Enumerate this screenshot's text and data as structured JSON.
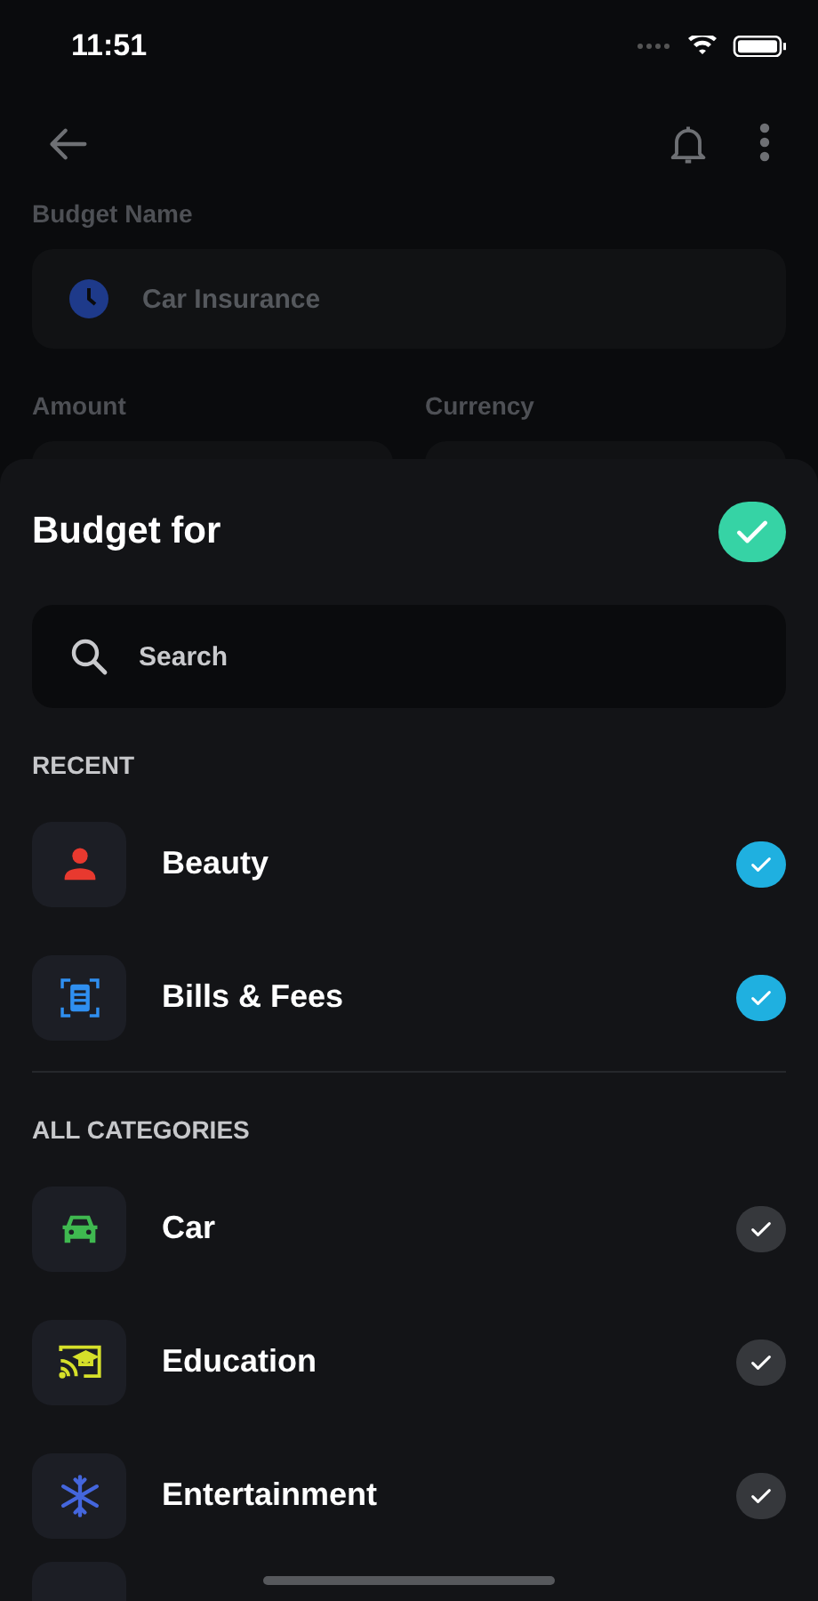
{
  "status_bar": {
    "time": "11:51"
  },
  "form": {
    "budget_name": {
      "label": "Budget Name",
      "value": "Car Insurance"
    },
    "amount": {
      "label": "Amount"
    },
    "currency": {
      "label": "Currency"
    }
  },
  "sheet": {
    "title": "Budget for",
    "search": {
      "placeholder": "Search"
    },
    "sections": [
      {
        "heading": "RECENT",
        "items": [
          {
            "label": "Beauty",
            "kind": "person",
            "color": "#e8392f",
            "selected": true
          },
          {
            "label": "Bills & Fees",
            "kind": "bill",
            "color": "#2f8ff0",
            "selected": true
          }
        ]
      },
      {
        "heading": "ALL CATEGORIES",
        "items": [
          {
            "label": "Car",
            "kind": "car",
            "color": "#3fb950",
            "selected": false
          },
          {
            "label": "Education",
            "kind": "education",
            "color": "#d6e02a",
            "selected": false
          },
          {
            "label": "Entertainment",
            "kind": "snowflake",
            "color": "#4466dd",
            "selected": false
          }
        ]
      }
    ]
  }
}
